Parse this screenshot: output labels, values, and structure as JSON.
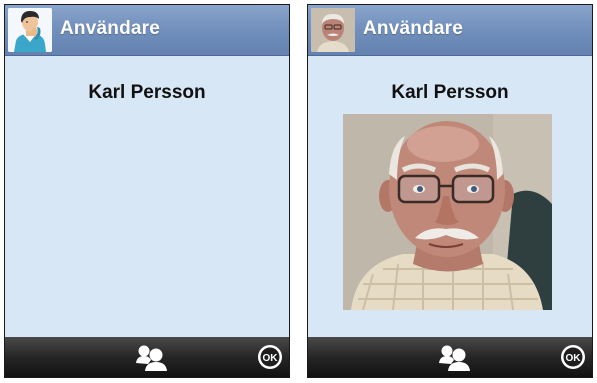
{
  "screens": [
    {
      "title": "Användare",
      "user_name": "Karl Persson",
      "title_icon": "user-avatar-icon",
      "has_photo": false
    },
    {
      "title": "Användare",
      "user_name": "Karl Persson",
      "title_icon": "user-photo-thumbnail",
      "has_photo": true
    }
  ],
  "toolbar": {
    "contacts_icon": "contacts-icon",
    "ok_label": "OK"
  },
  "colors": {
    "titlebar": "#7391bd",
    "background": "#d8e7f5",
    "toolbar": "#262626"
  }
}
